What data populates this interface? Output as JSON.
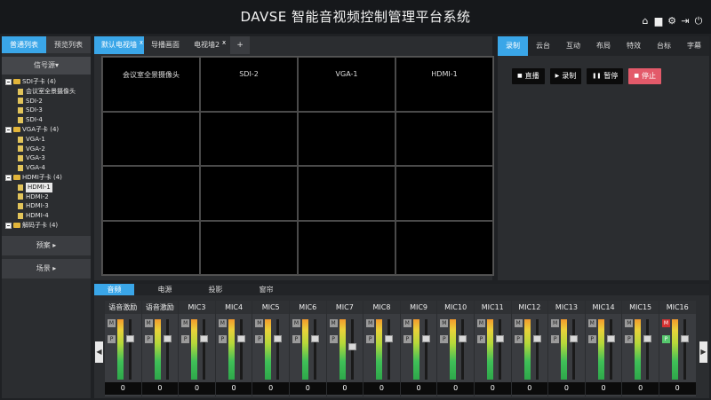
{
  "header": {
    "title": "DAVSE 智能音视频控制管理平台系统"
  },
  "left": {
    "tabs": [
      {
        "label": "普通列表",
        "active": true
      },
      {
        "label": "预览列表",
        "active": false
      }
    ],
    "signal_head": "信号源▾",
    "tree": [
      {
        "label": "SDI子卡 (4)",
        "children": [
          "会议室全景摄像头",
          "SDI-2",
          "SDI-3",
          "SDI-4"
        ]
      },
      {
        "label": "VGA子卡 (4)",
        "children": [
          "VGA-1",
          "VGA-2",
          "VGA-3",
          "VGA-4"
        ]
      },
      {
        "label": "HDMI子卡 (4)",
        "children": [
          "HDMI-1",
          "HDMI-2",
          "HDMI-3",
          "HDMI-4"
        ]
      },
      {
        "label": "解码子卡 (4)",
        "children": []
      }
    ],
    "selected": "HDMI-1",
    "preset_label": "预案 ▸",
    "scene_label": "场景 ▸"
  },
  "video": {
    "tabs": [
      {
        "label": "默认电视墙",
        "active": true,
        "closable": true
      },
      {
        "label": "导播画面",
        "active": false,
        "closable": false
      },
      {
        "label": "电视墙2",
        "active": false,
        "closable": true
      }
    ],
    "add_label": "+",
    "close_label": "x",
    "cells": [
      "会议室全景摄像头",
      "SDI-2",
      "VGA-1",
      "HDMI-1",
      "",
      "",
      "",
      "",
      "",
      "",
      "",
      "",
      "",
      "",
      "",
      ""
    ]
  },
  "right": {
    "tabs": [
      "录制",
      "云台",
      "互动",
      "布局",
      "特效",
      "台标",
      "字幕"
    ],
    "active_tab": "录制",
    "buttons": [
      {
        "icon": "camera-icon",
        "glyph": "■",
        "label": "直播"
      },
      {
        "icon": "play-icon",
        "glyph": "▶",
        "label": "录制"
      },
      {
        "icon": "pause-icon",
        "glyph": "❚❚",
        "label": "暂停"
      },
      {
        "icon": "stop-icon",
        "glyph": "■",
        "label": "停止"
      }
    ]
  },
  "audio": {
    "tabs": [
      "音频",
      "电源",
      "投影",
      "窗帘"
    ],
    "active_tab": "音频",
    "m_label": "M",
    "p_label": "P",
    "channels": [
      {
        "name": "语音激励",
        "value": "0",
        "muted": false,
        "p_on": false,
        "level": 0.7
      },
      {
        "name": "语音激励",
        "value": "0",
        "muted": false,
        "p_on": false,
        "level": 0.7
      },
      {
        "name": "MIC3",
        "value": "0",
        "muted": false,
        "p_on": false,
        "level": 0.7
      },
      {
        "name": "MIC4",
        "value": "0",
        "muted": false,
        "p_on": false,
        "level": 0.7
      },
      {
        "name": "MIC5",
        "value": "0",
        "muted": false,
        "p_on": false,
        "level": 0.7
      },
      {
        "name": "MIC6",
        "value": "0",
        "muted": false,
        "p_on": false,
        "level": 0.7
      },
      {
        "name": "MIC7",
        "value": "0",
        "muted": false,
        "p_on": false,
        "level": 0.55
      },
      {
        "name": "MIC8",
        "value": "0",
        "muted": false,
        "p_on": false,
        "level": 0.7
      },
      {
        "name": "MIC9",
        "value": "0",
        "muted": false,
        "p_on": false,
        "level": 0.7
      },
      {
        "name": "MIC10",
        "value": "0",
        "muted": false,
        "p_on": false,
        "level": 0.7
      },
      {
        "name": "MIC11",
        "value": "0",
        "muted": false,
        "p_on": false,
        "level": 0.7
      },
      {
        "name": "MIC12",
        "value": "0",
        "muted": false,
        "p_on": false,
        "level": 0.7
      },
      {
        "name": "MIC13",
        "value": "0",
        "muted": false,
        "p_on": false,
        "level": 0.7
      },
      {
        "name": "MIC14",
        "value": "0",
        "muted": false,
        "p_on": false,
        "level": 0.7
      },
      {
        "name": "MIC15",
        "value": "0",
        "muted": false,
        "p_on": false,
        "level": 0.7
      },
      {
        "name": "MIC16",
        "value": "0",
        "muted": true,
        "p_on": true,
        "level": 0.7
      }
    ],
    "prev_glyph": "◀",
    "next_glyph": "▶"
  },
  "icons": [
    "home-icon",
    "folder-icon",
    "gear-icon",
    "logout-icon",
    "power-icon"
  ],
  "icon_glyphs": [
    "⌂",
    "▆",
    "⚙",
    "⇥",
    "⏻"
  ]
}
